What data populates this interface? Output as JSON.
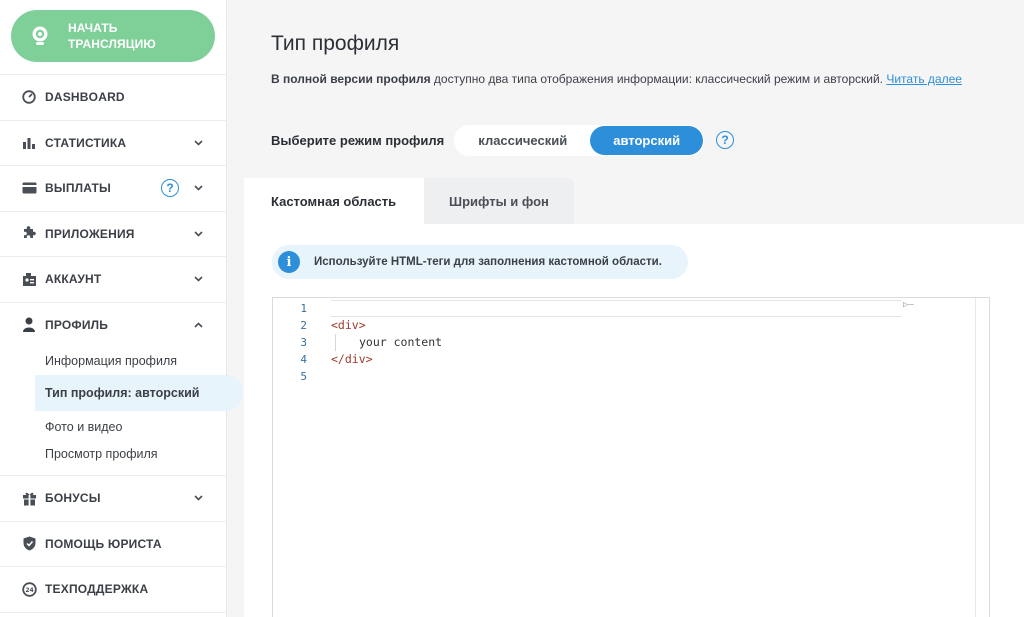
{
  "sidebar": {
    "start_button": "НАЧАТЬ\nТРАНСЛЯЦИЮ",
    "items": [
      {
        "label": "DASHBOARD",
        "icon": "dashboard-icon"
      },
      {
        "label": "СТАТИСТИКА",
        "icon": "bar-chart-icon"
      },
      {
        "label": "ВЫПЛАТЫ",
        "icon": "card-icon",
        "help": "?"
      },
      {
        "label": "ПРИЛОЖЕНИЯ",
        "icon": "puzzle-icon"
      },
      {
        "label": "АККАУНТ",
        "icon": "account-icon"
      },
      {
        "label": "ПРОФИЛЬ",
        "icon": "user-icon"
      },
      {
        "label": "БОНУСЫ",
        "icon": "gift-icon"
      },
      {
        "label": "ПОМОЩЬ ЮРИСТА",
        "icon": "shield-icon"
      },
      {
        "label": "ТЕХПОДДЕРЖКА",
        "icon": "support-24-icon"
      }
    ],
    "profile_sub": [
      "Информация профиля",
      "Тип профиля: авторский",
      "Фото и видео",
      "Просмотр профиля"
    ]
  },
  "main": {
    "title": "Тип профиля",
    "desc_bold": "В полной версии профиля",
    "desc_text": " доступно два типа отображения информации: классический режим и авторский. ",
    "desc_link": "Читать далее",
    "mode_label": "Выберите режим профиля",
    "mode_options": [
      "классический",
      "авторский"
    ],
    "mode_selected": "авторский",
    "help": "?",
    "tabs": [
      "Кастомная область",
      "Шрифты и фон"
    ],
    "hint": "Используйте HTML-теги для заполнения кастомной области.",
    "hint_icon": "i"
  },
  "editor": {
    "line_numbers": [
      "1",
      "2",
      "3",
      "4",
      "5"
    ],
    "lines": [
      "",
      "<div>",
      "your content",
      "</div>",
      ""
    ]
  },
  "colors": {
    "accent": "#2d8fd9",
    "start": "#7fcf98"
  }
}
